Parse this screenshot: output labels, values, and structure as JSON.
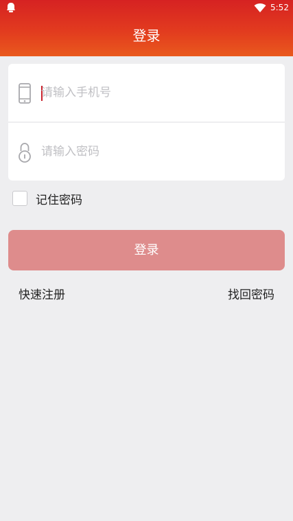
{
  "status_bar": {
    "time": "5:52"
  },
  "header": {
    "title": "登录"
  },
  "form": {
    "phone_placeholder": "请输入手机号",
    "password_placeholder": "请输入密码",
    "remember_label": "记住密码",
    "remember_checked": false,
    "login_label": "登录"
  },
  "links": {
    "register": "快速注册",
    "forgot_password": "找回密码"
  },
  "colors": {
    "header_top": "#d62222",
    "header_bottom": "#e9591d",
    "login_button": "#de8c8c",
    "cursor": "#c8202a",
    "background": "#eeeef0"
  }
}
